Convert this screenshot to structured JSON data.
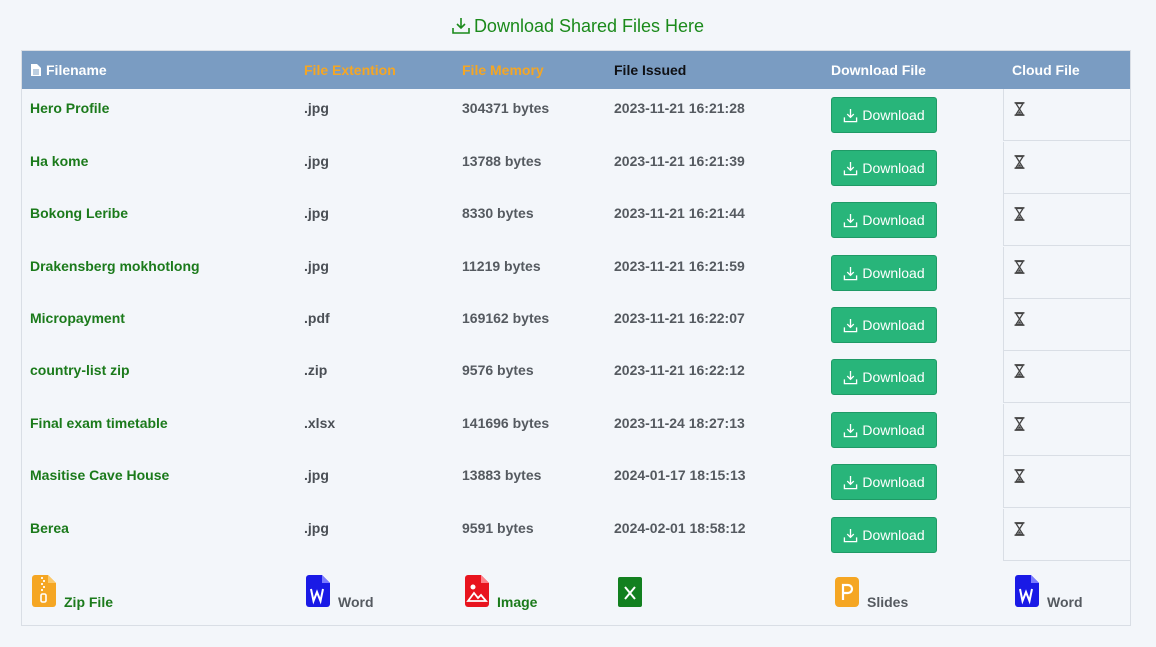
{
  "header": {
    "title": "Download Shared Files Here"
  },
  "table": {
    "columns": [
      "Filename",
      "File Extention",
      "File Memory",
      "File Issued",
      "Download File",
      "Cloud File"
    ],
    "download_label": "Download",
    "rows": [
      {
        "filename": "Hero Profile",
        "ext": ".jpg",
        "memory": "304371 bytes",
        "issued": "2023-11-21 16:21:28"
      },
      {
        "filename": "Ha kome",
        "ext": ".jpg",
        "memory": "13788 bytes",
        "issued": "2023-11-21 16:21:39"
      },
      {
        "filename": "Bokong Leribe",
        "ext": ".jpg",
        "memory": "8330 bytes",
        "issued": "2023-11-21 16:21:44"
      },
      {
        "filename": "Drakensberg mokhotlong",
        "ext": ".jpg",
        "memory": "11219 bytes",
        "issued": "2023-11-21 16:21:59"
      },
      {
        "filename": "Micropayment",
        "ext": ".pdf",
        "memory": "169162 bytes",
        "issued": "2023-11-21 16:22:07"
      },
      {
        "filename": "country-list zip",
        "ext": ".zip",
        "memory": "9576 bytes",
        "issued": "2023-11-21 16:22:12"
      },
      {
        "filename": "Final exam timetable",
        "ext": ".xlsx",
        "memory": "141696 bytes",
        "issued": "2023-11-24 18:27:13"
      },
      {
        "filename": "Masitise Cave House",
        "ext": ".jpg",
        "memory": "13883 bytes",
        "issued": "2024-01-17 18:15:13"
      },
      {
        "filename": "Berea",
        "ext": ".jpg",
        "memory": "9591 bytes",
        "issued": "2024-02-01 18:58:12"
      }
    ]
  },
  "footer": {
    "items": [
      {
        "label": "Zip File",
        "icon": "zip-file-icon",
        "color": "#f5a623",
        "labelColor": "#1b7a1b"
      },
      {
        "label": "Word",
        "icon": "word-icon",
        "color": "#1a1ae6",
        "labelColor": "#555a60"
      },
      {
        "label": "Image",
        "icon": "image-icon",
        "color": "#e8141e",
        "labelColor": "#1b7a1b"
      },
      {
        "label": "",
        "icon": "excel-icon",
        "color": "#12801f",
        "labelColor": "#555a60"
      },
      {
        "label": "Slides",
        "icon": "slides-icon",
        "color": "#f5a623",
        "labelColor": "#555a60"
      },
      {
        "label": "Word",
        "icon": "word-icon",
        "color": "#1a1ae6",
        "labelColor": "#555a60"
      }
    ]
  },
  "colors": {
    "header_bg": "#7a9cc2",
    "accent_orange": "#f5a623",
    "download_button": "#28b57a",
    "filename_green": "#1b7a1b"
  }
}
